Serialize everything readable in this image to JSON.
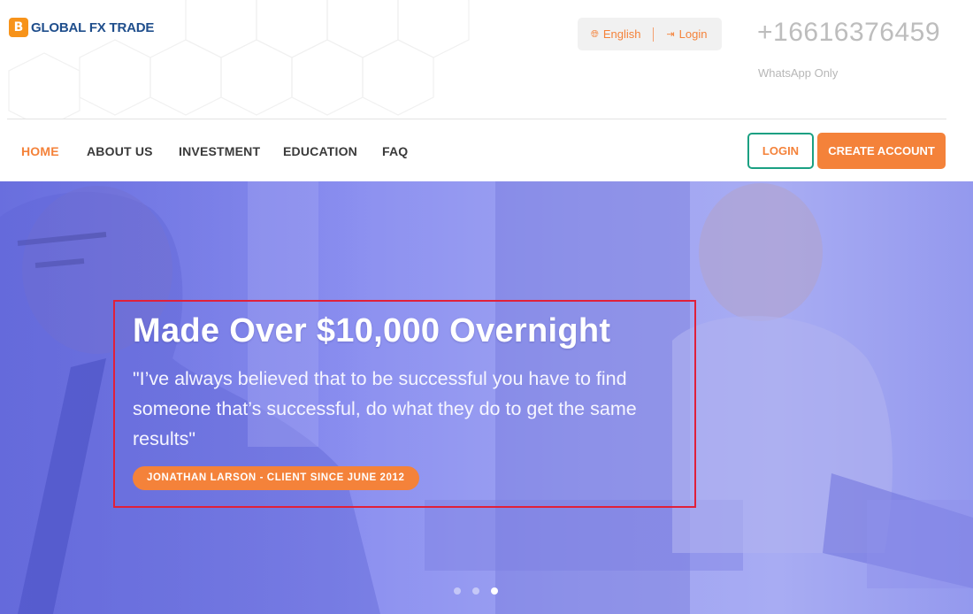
{
  "brand": {
    "logo_mark": "B",
    "name": "GLOBAL FX TRADE",
    "logo_icon": "bitcoin-icon"
  },
  "topbar": {
    "language_label": "English",
    "language_icon": "globe-icon",
    "login_label": "Login",
    "login_icon": "sign-in-icon",
    "phone": "+16616376459",
    "phone_note": "WhatsApp Only"
  },
  "nav": {
    "items": [
      {
        "label": "HOME",
        "active": true
      },
      {
        "label": "ABOUT US",
        "active": false
      },
      {
        "label": "INVESTMENT",
        "active": false
      },
      {
        "label": "EDUCATION",
        "active": false
      },
      {
        "label": "FAQ",
        "active": false
      }
    ],
    "login_button": "LOGIN",
    "create_account_button": "CREATE ACCOUNT"
  },
  "hero": {
    "title": "Made Over $10,000 Overnight",
    "quote": "\"I’ve always believed that to be successful you have to find someone that’s successful, do what they do to get the same results\"",
    "badge": "JONATHAN LARSON - CLIENT SINCE JUNE 2012",
    "slides_total": 3,
    "active_slide": 3
  },
  "colors": {
    "accent": "#f4823a",
    "brand_blue": "#1f4e8c",
    "login_border": "#1ba082",
    "hero_tint": "#8b8ff0",
    "highlight_border": "#e0203a"
  }
}
